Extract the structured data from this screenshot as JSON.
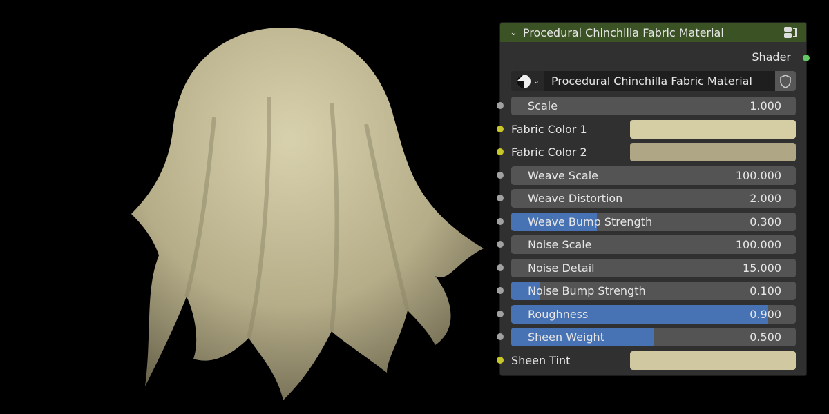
{
  "node": {
    "title": "Procedural Chinchilla Fabric Material",
    "output": "Shader",
    "material_name": "Procedural Chinchilla Fabric Material"
  },
  "inputs": [
    {
      "type": "slider",
      "label": "Scale",
      "value": "1.000",
      "fill": 0
    },
    {
      "type": "color",
      "label": "Fabric Color 1",
      "color": "#d5cea5"
    },
    {
      "type": "color",
      "label": "Fabric Color 2",
      "color": "#aea684"
    },
    {
      "type": "slider",
      "label": "Weave Scale",
      "value": "100.000",
      "fill": 0
    },
    {
      "type": "slider",
      "label": "Weave Distortion",
      "value": "2.000",
      "fill": 0
    },
    {
      "type": "slider",
      "label": "Weave Bump Strength",
      "value": "0.300",
      "fill": 0.3
    },
    {
      "type": "slider",
      "label": "Noise Scale",
      "value": "100.000",
      "fill": 0
    },
    {
      "type": "slider",
      "label": "Noise Detail",
      "value": "15.000",
      "fill": 0
    },
    {
      "type": "slider",
      "label": "Noise Bump Strength",
      "value": "0.100",
      "fill": 0.1
    },
    {
      "type": "slider",
      "label": "Roughness",
      "value": "0.900",
      "fill": 0.9
    },
    {
      "type": "slider",
      "label": "Sheen Weight",
      "value": "0.500",
      "fill": 0.5
    },
    {
      "type": "color",
      "label": "Sheen Tint",
      "color": "#d0c8a0"
    }
  ]
}
